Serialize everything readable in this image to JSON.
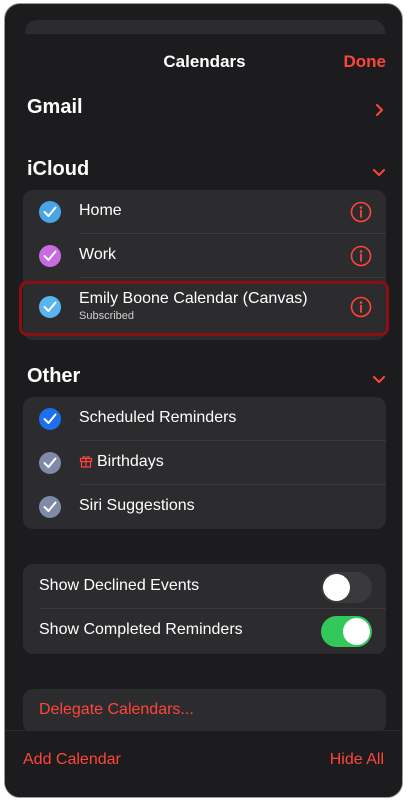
{
  "nav": {
    "title": "Calendars",
    "done_label": "Done"
  },
  "gmail": {
    "title": "Gmail"
  },
  "icloud": {
    "title": "iCloud",
    "items": [
      {
        "label": "Home",
        "color": "#4aa5e8"
      },
      {
        "label": "Work",
        "color": "#c66be0"
      },
      {
        "label": "Emily Boone Calendar (Canvas)",
        "subtitle": "Subscribed",
        "color": "#5ab4f0"
      }
    ]
  },
  "other": {
    "title": "Other",
    "items": [
      {
        "label": "Scheduled Reminders",
        "color": "#1e6ef0"
      },
      {
        "label": "Birthdays",
        "color": "#7f8aa8",
        "icon": "gift-icon"
      },
      {
        "label": "Siri Suggestions",
        "color": "#7f8aa8"
      }
    ]
  },
  "settings": {
    "show_declined_label": "Show Declined Events",
    "show_declined_on": false,
    "show_completed_label": "Show Completed Reminders",
    "show_completed_on": true
  },
  "delegate": {
    "label": "Delegate Calendars..."
  },
  "bottom": {
    "add_label": "Add Calendar",
    "hide_label": "Hide All"
  },
  "colors": {
    "accent": "#ff453a",
    "toggle_on": "#34c759",
    "toggle_off": "#3a3a3c",
    "highlight": "#8b0e14"
  }
}
